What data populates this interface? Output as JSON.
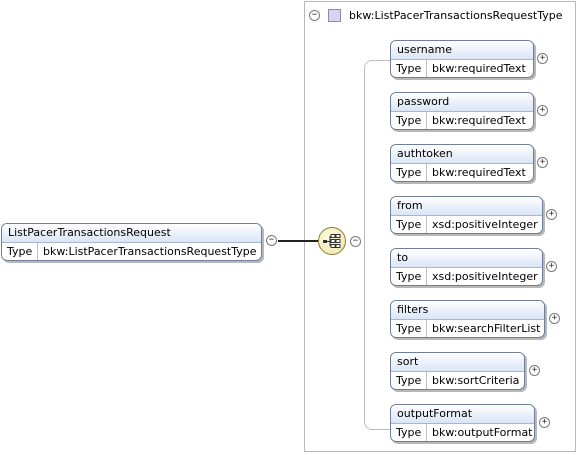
{
  "root_element": {
    "name": "ListPacerTransactionsRequest",
    "type_label": "Type",
    "type_value": "bkw:ListPacerTransactionsRequestType",
    "toggle": "−"
  },
  "complex_type": {
    "title": "bkw:ListPacerTransactionsRequestType",
    "toggle": "−"
  },
  "sequence": {
    "toggle": "−",
    "icon": "sequence-compositor-icon"
  },
  "children": [
    {
      "name": "username",
      "type_label": "Type",
      "type_value": "bkw:requiredText",
      "toggle": "+"
    },
    {
      "name": "password",
      "type_label": "Type",
      "type_value": "bkw:requiredText",
      "toggle": "+"
    },
    {
      "name": "authtoken",
      "type_label": "Type",
      "type_value": "bkw:requiredText",
      "toggle": "+"
    },
    {
      "name": "from",
      "type_label": "Type",
      "type_value": "xsd:positiveInteger",
      "toggle": "+"
    },
    {
      "name": "to",
      "type_label": "Type",
      "type_value": "xsd:positiveInteger",
      "toggle": "+"
    },
    {
      "name": "filters",
      "type_label": "Type",
      "type_value": "bkw:searchFilterList",
      "toggle": "+"
    },
    {
      "name": "sort",
      "type_label": "Type",
      "type_value": "bkw:sortCriteria",
      "toggle": "+"
    },
    {
      "name": "outputFormat",
      "type_label": "Type",
      "type_value": "bkw:outputFormat",
      "toggle": "+"
    }
  ],
  "colors": {
    "header_gradient_top": "#ffffff",
    "header_gradient_bottom": "#d9e5f6",
    "box_border": "#6f7e99",
    "compositor_fill": "#efe3a6",
    "type_square": "#dcd3f0"
  }
}
